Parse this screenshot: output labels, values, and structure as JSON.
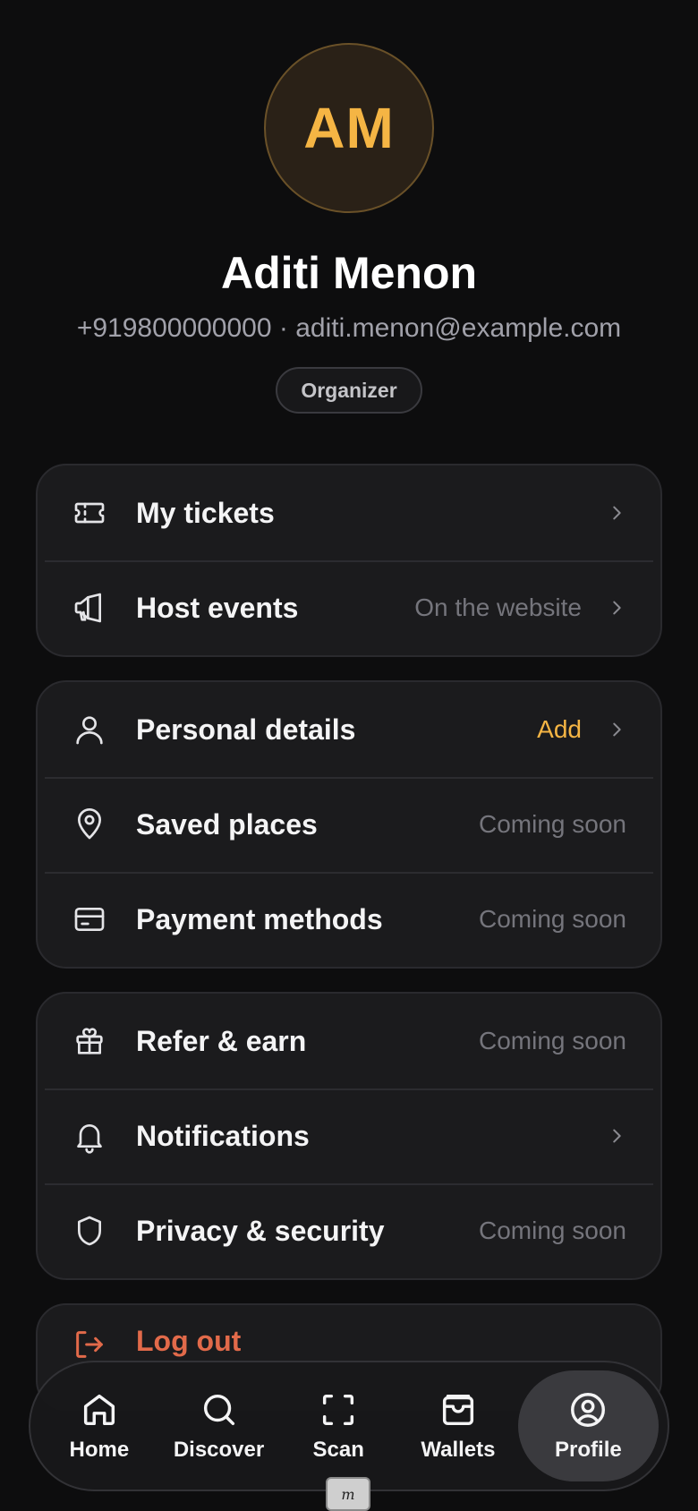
{
  "profile": {
    "initials": "AM",
    "name": "Aditi Menon",
    "contact": "+919800000000 · aditi.menon@example.com",
    "role": "Organizer"
  },
  "colors": {
    "accent": "#f5b544",
    "danger": "#e26a4a",
    "background": "#0d0d0e",
    "card": "#1b1b1d"
  },
  "groups": [
    {
      "items": [
        {
          "name": "my-tickets",
          "icon": "ticket-icon",
          "label": "My tickets",
          "meta": "",
          "chevron": true
        },
        {
          "name": "host-events",
          "icon": "megaphone-icon",
          "label": "Host events",
          "meta": "On the website",
          "chevron": true
        }
      ]
    },
    {
      "items": [
        {
          "name": "personal-details",
          "icon": "user-icon",
          "label": "Personal details",
          "meta": "Add",
          "accent": true,
          "chevron": true
        },
        {
          "name": "saved-places",
          "icon": "map-pin-icon",
          "label": "Saved places",
          "meta": "Coming soon",
          "chevron": false
        },
        {
          "name": "payment-methods",
          "icon": "credit-card-icon",
          "label": "Payment methods",
          "meta": "Coming soon",
          "chevron": false
        }
      ]
    },
    {
      "items": [
        {
          "name": "refer-earn",
          "icon": "gift-icon",
          "label": "Refer & earn",
          "meta": "Coming soon",
          "chevron": false
        },
        {
          "name": "notifications",
          "icon": "bell-icon",
          "label": "Notifications",
          "meta": "",
          "chevron": true
        },
        {
          "name": "privacy-security",
          "icon": "shield-icon",
          "label": "Privacy & security",
          "meta": "Coming soon",
          "chevron": false
        }
      ]
    }
  ],
  "logout": {
    "icon": "logout-icon",
    "label": "Log out"
  },
  "nav": [
    {
      "name": "home",
      "icon": "home-icon",
      "label": "Home",
      "active": false
    },
    {
      "name": "discover",
      "icon": "search-icon",
      "label": "Discover",
      "active": false
    },
    {
      "name": "scan",
      "icon": "scan-icon",
      "label": "Scan",
      "active": false
    },
    {
      "name": "wallets",
      "icon": "wallet-icon",
      "label": "Wallets",
      "active": false
    },
    {
      "name": "profile",
      "icon": "profile-icon",
      "label": "Profile",
      "active": true
    }
  ]
}
